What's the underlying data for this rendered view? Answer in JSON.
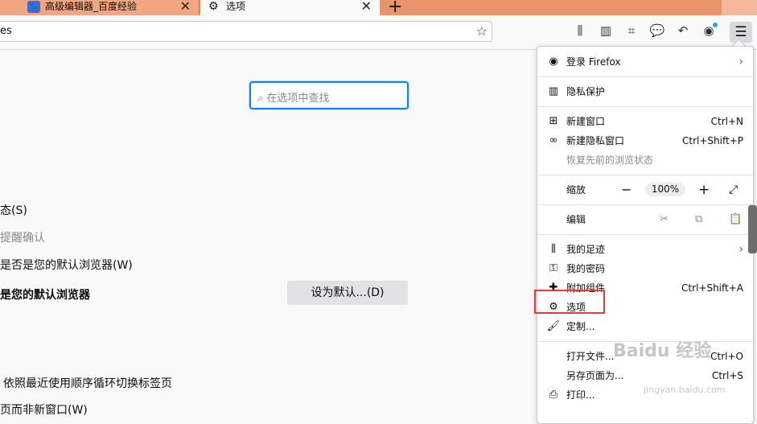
{
  "tabs": [
    {
      "label": "高级编辑器_百度经验",
      "close": "✕"
    },
    {
      "label": "选项",
      "close": "✕"
    }
  ],
  "new_tab": "+",
  "urlbar": {
    "text": "es"
  },
  "search": {
    "placeholder": "在选项中查找"
  },
  "prefs": [
    {
      "text": "⁠态(S)"
    },
    {
      "text": "提醒确认"
    },
    {
      "text": "是否是您的默认浏览器(W)"
    },
    {
      "text": "是您的默认浏览器"
    },
    {
      "text": "依照最近使用顺序循环切换标签页"
    },
    {
      "text": "页而非新窗口(W)"
    }
  ],
  "set_default_button": "设为默认...(D)",
  "menu": {
    "signin": "登录 Firefox",
    "privacy": "隐私保护",
    "new_window": {
      "label": "新建窗口",
      "shortcut": "Ctrl+N"
    },
    "private_window": {
      "label": "新建隐私窗口",
      "shortcut": "Ctrl+Shift+P"
    },
    "restore": "恢复先前的浏览状态",
    "zoom": {
      "label": "缩放",
      "value": "100%"
    },
    "edit": "编辑",
    "library": "我的足迹",
    "logins": "我的密码",
    "addons": {
      "label": "附加组件",
      "shortcut": "Ctrl+Shift+A"
    },
    "options": "选项",
    "customize": "定制...",
    "open_file": {
      "label": "打开文件...",
      "shortcut": "Ctrl+O"
    },
    "save_page": {
      "label": "另存页面为...",
      "shortcut": "Ctrl+S"
    },
    "print": "打印..."
  },
  "watermark": {
    "brand": "Baidu 经验",
    "url": "jingyan.baidu.com"
  },
  "colors": {
    "tabstrip": "#e8936a",
    "focus": "#0a84ff",
    "highlight": "#e53935"
  }
}
